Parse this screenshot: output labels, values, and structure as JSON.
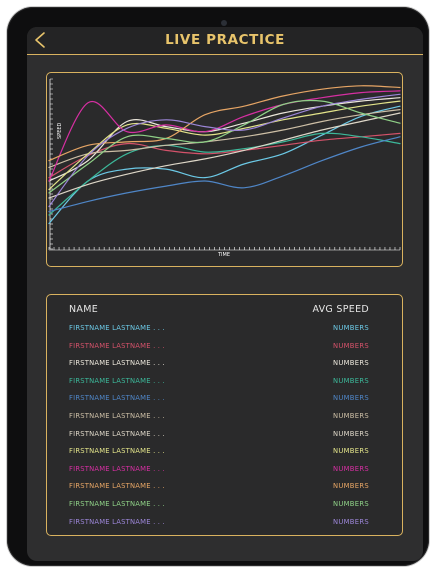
{
  "header": {
    "title": "LIVE PRACTICE"
  },
  "chart_data": {
    "type": "line",
    "xlabel": "TIME",
    "ylabel": "SPEED",
    "grid": false,
    "x": [
      0,
      1,
      2,
      3,
      4,
      5,
      6,
      7,
      8,
      9
    ],
    "series": [
      {
        "color": "#6cc9e6",
        "values": [
          0.15,
          0.4,
          0.47,
          0.47,
          0.42,
          0.5,
          0.56,
          0.67,
          0.78,
          0.84
        ]
      },
      {
        "color": "#d4526a",
        "values": [
          0.42,
          0.55,
          0.62,
          0.58,
          0.56,
          0.58,
          0.61,
          0.64,
          0.66,
          0.68
        ]
      },
      {
        "color": "#ece7dc",
        "values": [
          0.4,
          0.52,
          0.75,
          0.72,
          0.69,
          0.74,
          0.8,
          0.84,
          0.87,
          0.89
        ]
      },
      {
        "color": "#3cb89a",
        "values": [
          0.2,
          0.4,
          0.56,
          0.61,
          0.57,
          0.59,
          0.63,
          0.68,
          0.66,
          0.62
        ]
      },
      {
        "color": "#4f86c7",
        "values": [
          0.22,
          0.28,
          0.33,
          0.37,
          0.4,
          0.36,
          0.43,
          0.52,
          0.6,
          0.66
        ]
      },
      {
        "color": "#cdbfa6",
        "values": [
          0.48,
          0.56,
          0.58,
          0.61,
          0.63,
          0.66,
          0.7,
          0.75,
          0.79,
          0.82
        ]
      },
      {
        "color": "#ded7c8",
        "values": [
          0.3,
          0.38,
          0.44,
          0.49,
          0.53,
          0.58,
          0.64,
          0.7,
          0.75,
          0.8
        ]
      },
      {
        "color": "#e3e48a",
        "values": [
          0.35,
          0.56,
          0.73,
          0.71,
          0.67,
          0.71,
          0.76,
          0.8,
          0.84,
          0.87
        ]
      },
      {
        "color": "#d62fa2",
        "values": [
          0.4,
          0.86,
          0.69,
          0.73,
          0.69,
          0.78,
          0.85,
          0.89,
          0.92,
          0.93
        ]
      },
      {
        "color": "#e6a565",
        "values": [
          0.52,
          0.61,
          0.63,
          0.65,
          0.79,
          0.84,
          0.9,
          0.94,
          0.96,
          0.95
        ]
      },
      {
        "color": "#8fd187",
        "values": [
          0.33,
          0.5,
          0.66,
          0.65,
          0.63,
          0.73,
          0.85,
          0.87,
          0.8,
          0.74
        ]
      },
      {
        "color": "#9c86d8",
        "values": [
          0.25,
          0.55,
          0.71,
          0.76,
          0.72,
          0.7,
          0.77,
          0.84,
          0.88,
          0.91
        ]
      }
    ]
  },
  "table": {
    "col_name": "NAME",
    "col_speed": "AVG SPEED",
    "rows": [
      {
        "name": "FIRSTNAME LASTNAME . . .",
        "speed": "NUMBERS",
        "color": "#6cc9e6"
      },
      {
        "name": "FIRSTNAME LASTNAME . . .",
        "speed": "NUMBERS",
        "color": "#d4526a"
      },
      {
        "name": "FIRSTNAME LASTNAME . . .",
        "speed": "NUMBERS",
        "color": "#ece7dc"
      },
      {
        "name": "FIRSTNAME LASTNAME . . .",
        "speed": "NUMBERS",
        "color": "#3cb89a"
      },
      {
        "name": "FIRSTNAME LASTNAME . . .",
        "speed": "NUMBERS",
        "color": "#4f86c7"
      },
      {
        "name": "FIRSTNAME LASTNAME . . .",
        "speed": "NUMBERS",
        "color": "#cdbfa6"
      },
      {
        "name": "FIRSTNAME LASTNAME . . .",
        "speed": "NUMBERS",
        "color": "#ded7c8"
      },
      {
        "name": "FIRSTNAME LASTNAME . . .",
        "speed": "NUMBERS",
        "color": "#e3e48a"
      },
      {
        "name": "FIRSTNAME LASTNAME . . .",
        "speed": "NUMBERS",
        "color": "#d62fa2"
      },
      {
        "name": "FIRSTNAME LASTNAME . . .",
        "speed": "NUMBERS",
        "color": "#e6a565"
      },
      {
        "name": "FIRSTNAME LASTNAME . . .",
        "speed": "NUMBERS",
        "color": "#8fd187"
      },
      {
        "name": "FIRSTNAME LASTNAME . . .",
        "speed": "NUMBERS",
        "color": "#9c86d8"
      }
    ]
  },
  "theme": {
    "accent": "#d9b25f",
    "title_color": "#e8c46b",
    "background": "#2e2e2f"
  }
}
